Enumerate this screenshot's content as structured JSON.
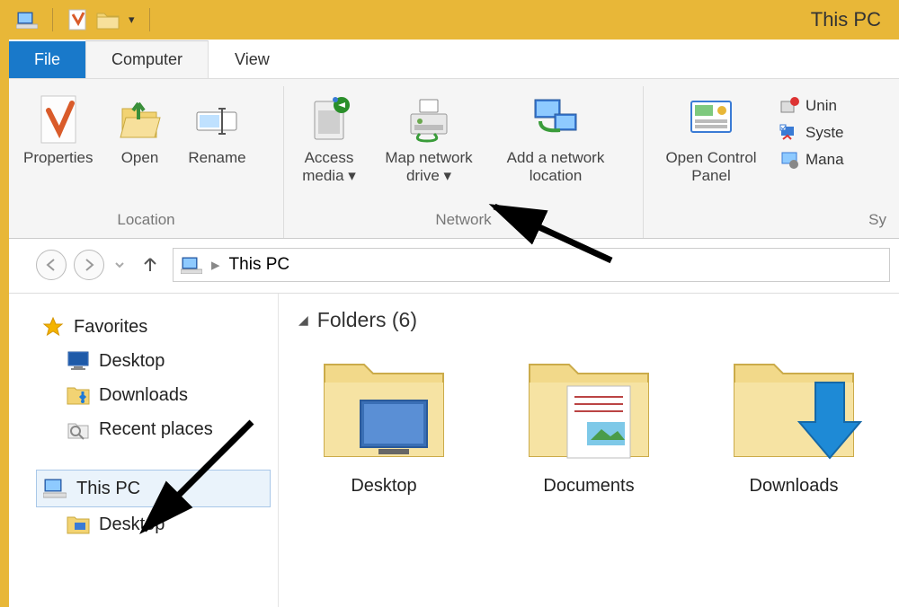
{
  "titlebar": {
    "title": "This PC"
  },
  "tabs": {
    "file": "File",
    "computer": "Computer",
    "view": "View"
  },
  "ribbon": {
    "location": {
      "label": "Location",
      "properties": "Properties",
      "open": "Open",
      "rename": "Rename"
    },
    "network": {
      "label": "Network",
      "access_media": "Access\nmedia ▾",
      "map_drive": "Map network\ndrive ▾",
      "add_location": "Add a network\nlocation"
    },
    "system": {
      "label": "Sy",
      "open_cp": "Open Control\nPanel",
      "unin": "Unin",
      "syste": "Syste",
      "mana": "Mana"
    }
  },
  "nav": {
    "location": "This PC"
  },
  "sidebar": {
    "favorites": "Favorites",
    "desktop": "Desktop",
    "downloads": "Downloads",
    "recent": "Recent places",
    "this_pc": "This PC",
    "desktop2": "Desktop"
  },
  "main": {
    "section": "Folders (6)",
    "items": [
      {
        "label": "Desktop"
      },
      {
        "label": "Documents"
      },
      {
        "label": "Downloads"
      }
    ]
  }
}
